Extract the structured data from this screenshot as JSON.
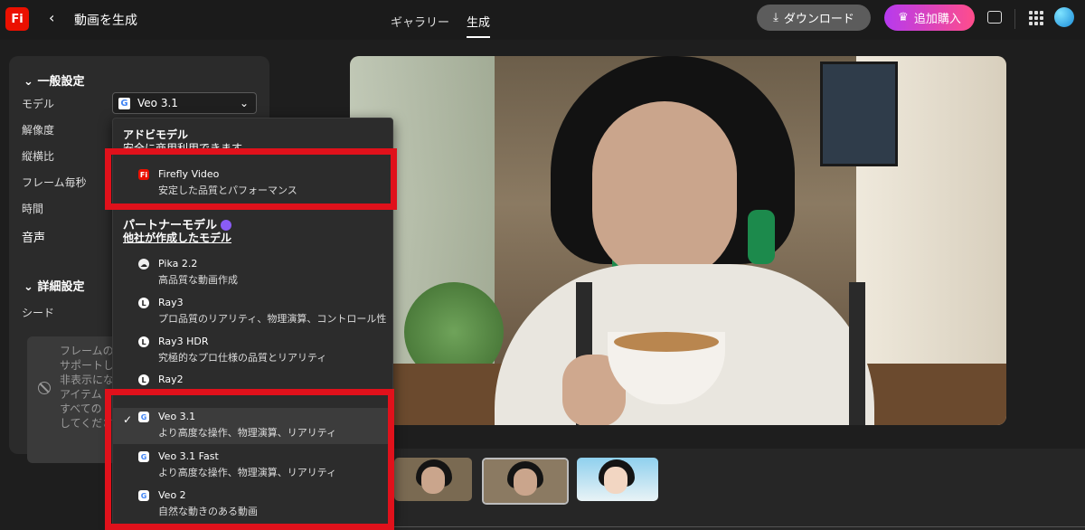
{
  "header": {
    "logo": "Fi",
    "back_icon": "chevron-left-icon",
    "title": "動画を生成",
    "tabs": [
      {
        "label": "ギャラリー",
        "active": false
      },
      {
        "label": "生成",
        "active": true
      }
    ],
    "download_label": "ダウンロード",
    "buy_label": "追加購入",
    "accent_gradient": [
      "#b63aef",
      "#ff4d8b"
    ]
  },
  "settings": {
    "general_title": "一般設定",
    "rows": [
      "モデル",
      "解像度",
      "縦横比",
      "フレーム毎秒",
      "時間",
      "音声"
    ],
    "model_value": "Veo 3.1",
    "advanced_title": "詳細設定",
    "seed_label": "シード",
    "notice_text": "フレームの\nサポートし\n非表示にな\nアイテム\nすべての\nしてくださ"
  },
  "dropdown": {
    "adobe_header": "アドビモデル",
    "adobe_sub": "安全に商用利用できます",
    "adobe_items": [
      {
        "name": "Firefly Video",
        "desc": "安定した品質とパフォーマンス",
        "icon": "firefly-icon"
      }
    ],
    "partner_header": "パートナーモデル",
    "partner_sub": "他社が作成したモデル",
    "partner_items": [
      {
        "name": "Pika 2.2",
        "desc": "高品質な動画作成",
        "icon": "pika-icon"
      },
      {
        "name": "Ray3",
        "desc": "プロ品質のリアリティ、物理演算、コントロール性",
        "icon": "luma-icon"
      },
      {
        "name": "Ray3 HDR",
        "desc": "究極的なプロ仕様の品質とリアリティ",
        "icon": "luma-icon"
      },
      {
        "name": "Ray2",
        "desc": "",
        "icon": "luma-icon"
      },
      {
        "name": "Veo 3.1",
        "desc": "より高度な操作、物理演算、リアリティ",
        "icon": "google-icon",
        "selected": true
      },
      {
        "name": "Veo 3.1 Fast",
        "desc": "より高度な操作、物理演算、リアリティ",
        "icon": "google-icon"
      },
      {
        "name": "Veo 2",
        "desc": "自然な動きのある動画",
        "icon": "google-icon"
      }
    ]
  },
  "highlight_color": "#e0111b"
}
